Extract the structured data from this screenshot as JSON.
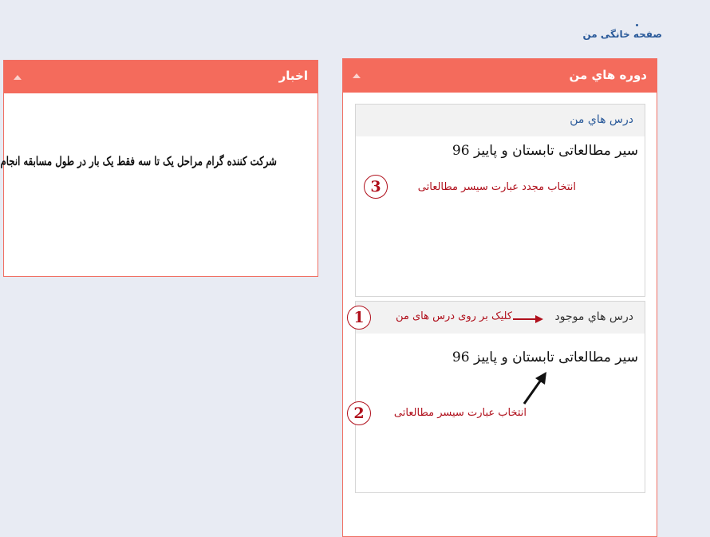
{
  "breadcrumb": {
    "home_label": "صفحه خانگی من"
  },
  "news_panel": {
    "title": "اخبار",
    "message": "شرکت کننده گرام مراحل یک تا سه فقط یک بار در طول مسابقه انجام می گیرد"
  },
  "courses_panel": {
    "title": "دوره هاي من",
    "my_courses": {
      "header": "درس هاي من",
      "course": "سیر مطالعاتی تابستان و پاییز 96"
    },
    "available_courses": {
      "header": "درس هاي موجود",
      "course": "سیر مطالعاتی تابستان و پاییز 96"
    }
  },
  "annotations": {
    "step1": {
      "number": "1",
      "text": "کلیک بر روی درس های من"
    },
    "step2": {
      "number": "2",
      "text": "انتخاب عبارت سیسر مطالعاتی"
    },
    "step3": {
      "number": "3",
      "text": "انتخاب مجدد عبارت سیسر مطالعاتی"
    }
  },
  "colors": {
    "panel_header": "#f46b5c",
    "panel_border": "#f07064",
    "page_bg": "#e8ebf3",
    "link_blue": "#2a5a9a",
    "annotation_red": "#b0101c"
  },
  "icons": {
    "collapse": "caret-up-icon",
    "arrow": "arrow-icon"
  }
}
